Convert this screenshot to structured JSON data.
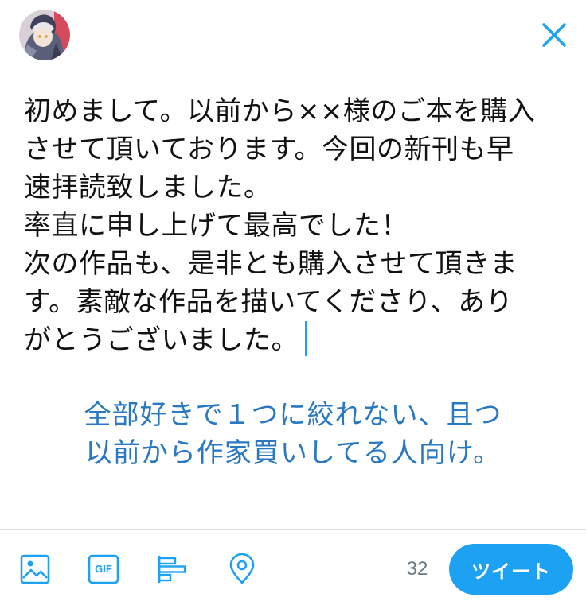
{
  "header": {
    "avatar_icon": "user-avatar",
    "close_icon": "close-icon"
  },
  "composer": {
    "lines": [
      "初めまして。以前から××様のご本を購入",
      "させて頂いております。今回の新刊も早",
      "速拝読致しました。",
      "率直に申し上げて最高でした！",
      "次の作品も、是非とも購入させて頂きま",
      "す。素敵な作品を描いてくださり、あり",
      "がとうございました。"
    ]
  },
  "annotation": {
    "lines": [
      "全部好きで１つに絞れない、且つ",
      "以前から作家買いしてる人向け。"
    ]
  },
  "toolbar": {
    "icons": [
      "image-icon",
      "gif-icon",
      "poll-icon",
      "location-icon"
    ],
    "gif_label": "GIF",
    "char_count": "32",
    "tweet_label": "ツイート"
  },
  "colors": {
    "accent": "#1da1f2",
    "icon": "#1da1f2",
    "annotation_text": "#2b78c2",
    "body_text": "#111111",
    "count_text": "#6b7882",
    "divider": "#d9dde0"
  }
}
